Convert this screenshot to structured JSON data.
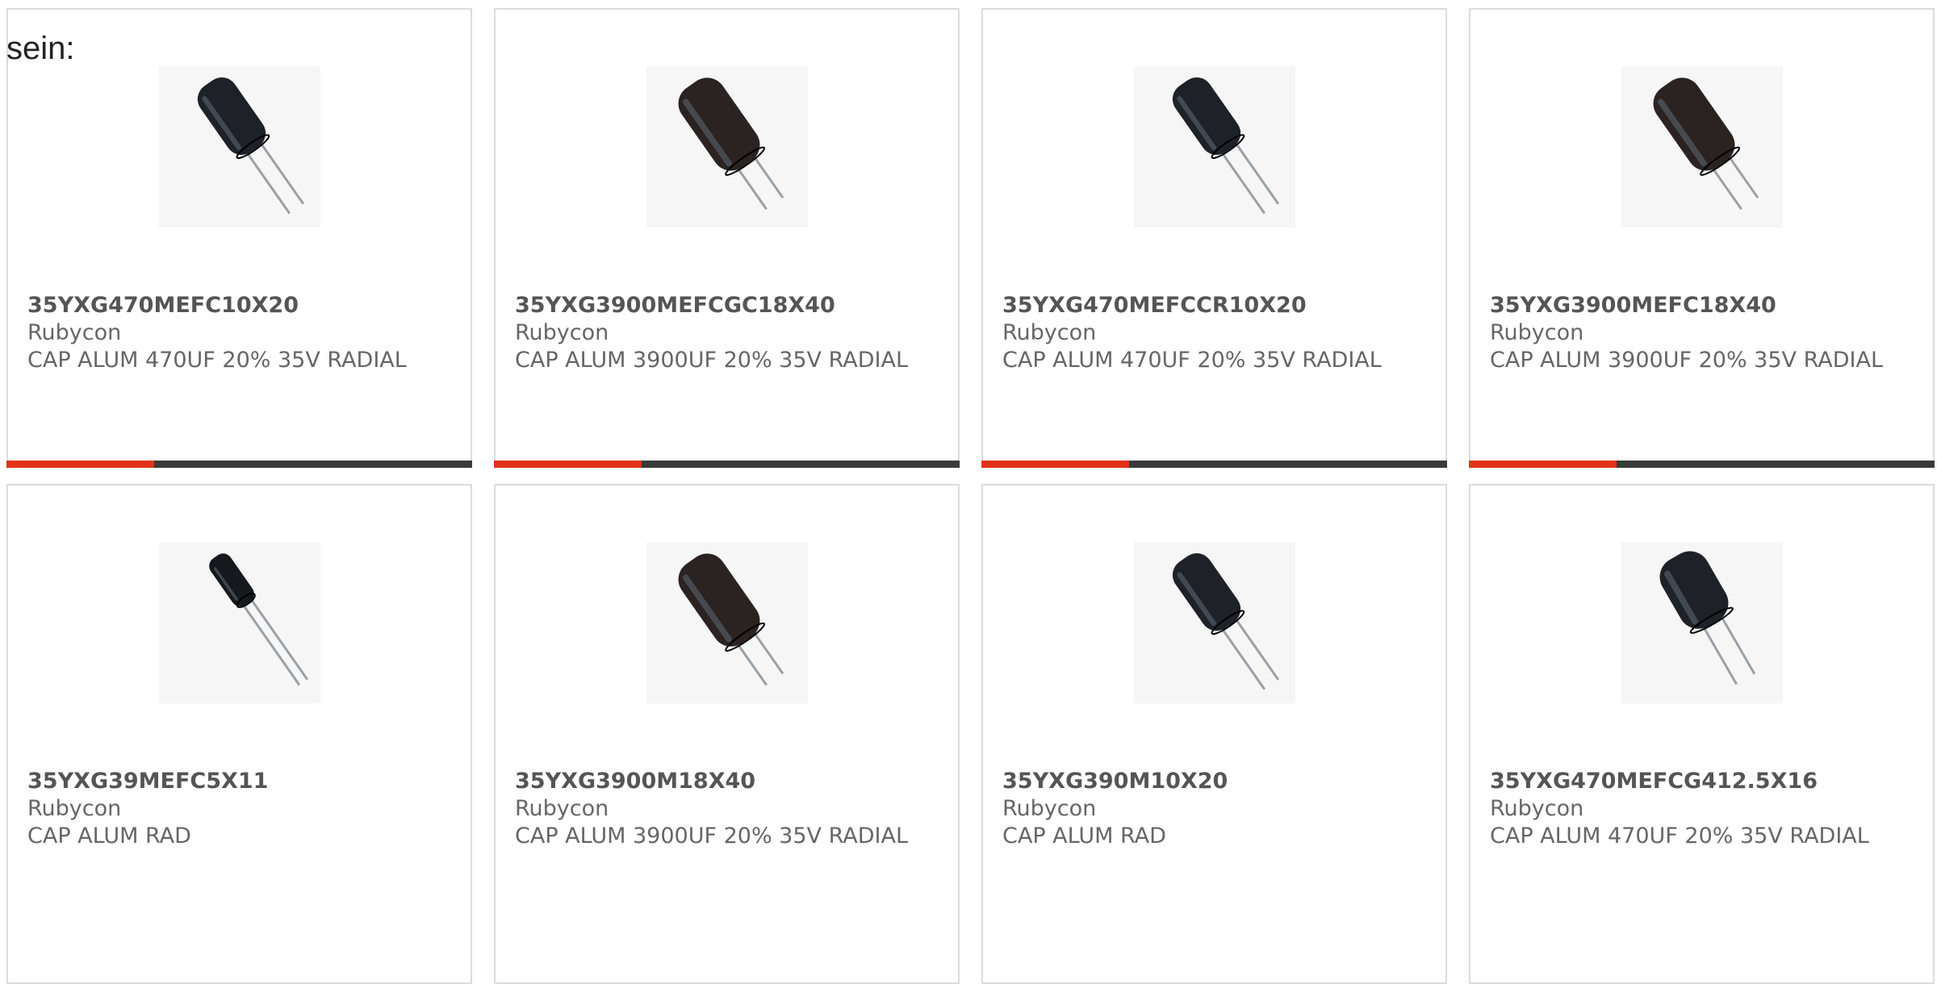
{
  "heading": "sein:",
  "colors": {
    "accent": "#e2331a",
    "bar": "#3a3a3a",
    "border": "#dcdcdc"
  },
  "products": [
    {
      "part": "35YXG470MEFC10X20",
      "mfr": "Rubycon",
      "desc": "CAP ALUM 470UF 20% 35V RADIAL",
      "icon": "capacitor-icon"
    },
    {
      "part": "35YXG3900MEFCGC18X40",
      "mfr": "Rubycon",
      "desc": "CAP ALUM 3900UF 20% 35V RADIAL",
      "icon": "capacitor-icon"
    },
    {
      "part": "35YXG470MEFCCR10X20",
      "mfr": "Rubycon",
      "desc": "CAP ALUM 470UF 20% 35V RADIAL",
      "icon": "capacitor-icon"
    },
    {
      "part": "35YXG3900MEFC18X40",
      "mfr": "Rubycon",
      "desc": "CAP ALUM 3900UF 20% 35V RADIAL",
      "icon": "capacitor-icon"
    },
    {
      "part": "35YXG39MEFC5X11",
      "mfr": "Rubycon",
      "desc": "CAP ALUM RAD",
      "icon": "capacitor-icon"
    },
    {
      "part": "35YXG3900M18X40",
      "mfr": "Rubycon",
      "desc": "CAP ALUM 3900UF 20% 35V RADIAL",
      "icon": "capacitor-icon"
    },
    {
      "part": "35YXG390M10X20",
      "mfr": "Rubycon",
      "desc": "CAP ALUM RAD",
      "icon": "capacitor-icon"
    },
    {
      "part": "35YXG470MEFCG412.5X16",
      "mfr": "Rubycon",
      "desc": "CAP ALUM 470UF 20% 35V RADIAL",
      "icon": "capacitor-icon"
    }
  ]
}
